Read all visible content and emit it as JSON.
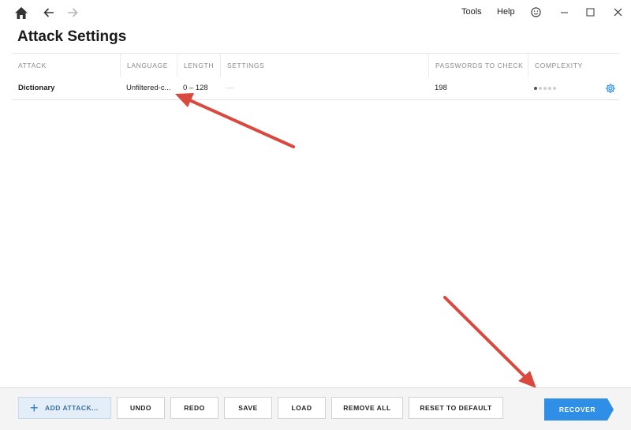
{
  "titlebar": {
    "menu": [
      "Tools",
      "Help"
    ]
  },
  "page": {
    "title": "Attack Settings"
  },
  "table": {
    "columns": [
      "ATTACK",
      "LANGUAGE",
      "LENGTH",
      "SETTINGS",
      "PASSWORDS TO CHECK",
      "COMPLEXITY"
    ],
    "rows": [
      {
        "attack": "Dictionary",
        "language": "Unfiltered-c...",
        "length": "0 – 128",
        "settings": "—",
        "passwords": "198",
        "complexity_level": 1,
        "complexity_max": 5
      }
    ]
  },
  "footer": {
    "add": "ADD ATTACK...",
    "undo": "UNDO",
    "redo": "REDO",
    "save": "SAVE",
    "load": "LOAD",
    "remove_all": "REMOVE ALL",
    "reset": "RESET TO DEFAULT",
    "recover": "RECOVER"
  },
  "colors": {
    "accent": "#2f8fe6",
    "annotation_arrow": "#d9493e"
  }
}
